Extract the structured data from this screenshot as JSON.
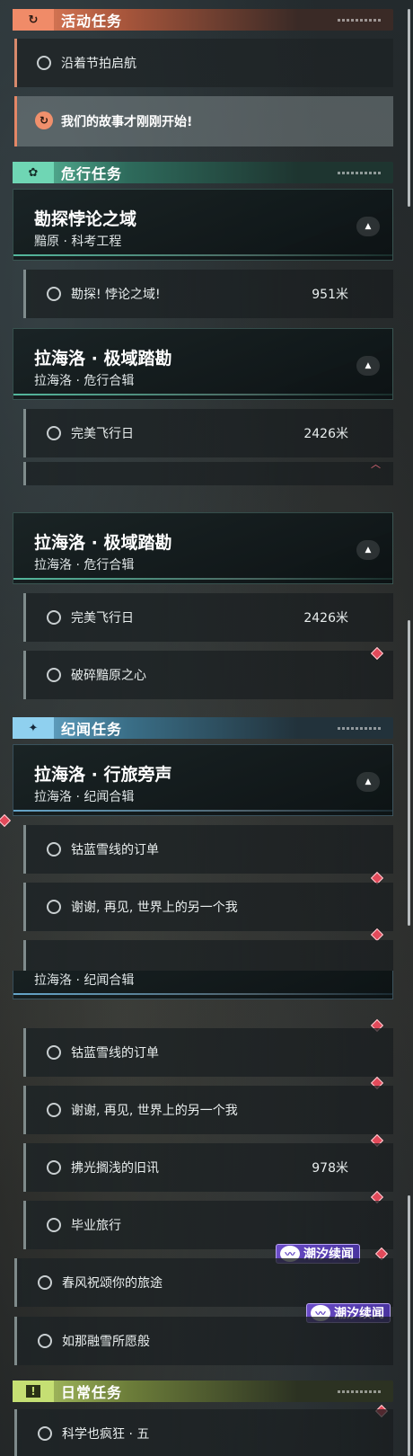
{
  "sections": {
    "activity": {
      "title": "活动任务",
      "icon": "↻"
    },
    "danger": {
      "title": "危行任务",
      "icon": "✿"
    },
    "story": {
      "title": "纪闻任务",
      "icon": "✦"
    },
    "daily": {
      "title": "日常任务",
      "icon": "!"
    }
  },
  "activity_quest": {
    "label": "沿着节拍启航"
  },
  "tracked_quest": {
    "label": "我们的故事才刚刚开始!",
    "icon": "↻"
  },
  "danger_groups": [
    {
      "title": "勘探悖论之域",
      "subtitle": "黯原 · 科考工程",
      "quests": [
        {
          "label": "勘探! 悖论之域!",
          "distance": "951米"
        }
      ]
    },
    {
      "title": "拉海洛 · 极域踏勘",
      "subtitle": "拉海洛 · 危行合辑",
      "quests": [
        {
          "label": "完美飞行日",
          "distance": "2426米"
        },
        {
          "label": "破碎黯原之心",
          "distance": ""
        }
      ]
    }
  ],
  "story_group": {
    "title": "拉海洛 · 行旅旁声",
    "subtitle": "拉海洛 · 纪闻合辑",
    "quests": [
      {
        "label": "钴蓝雪线的订单",
        "distance": ""
      },
      {
        "label": "谢谢, 再见, 世界上的另一个我",
        "distance": ""
      },
      {
        "label": "拂光搁浅的旧讯",
        "distance": "978米"
      },
      {
        "label": "毕业旅行",
        "distance": ""
      }
    ]
  },
  "tide_quests": [
    {
      "label": "春风祝颂你的旅途",
      "badge": "潮汐续闻"
    },
    {
      "label": "如那融雪所愿般",
      "badge": "潮汐续闻"
    }
  ],
  "daily_quest": {
    "label": "科学也疯狂 · 五"
  },
  "colors": {
    "activity": "#e9835e",
    "danger": "#5fc4a3",
    "story": "#6fb3d6",
    "daily": "#b6cf6a",
    "marker": "#e24a5a",
    "tide_badge": "#6b4cc8"
  }
}
